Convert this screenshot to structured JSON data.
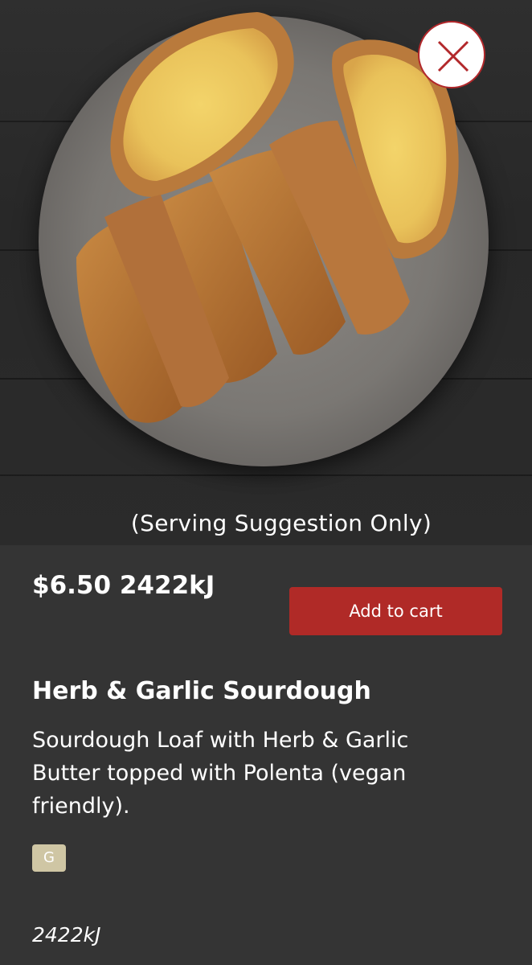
{
  "hero": {
    "caption": "(Serving Suggestion Only)",
    "image_description_icon": "bread-plate-image"
  },
  "close_icon": "close-icon",
  "product": {
    "price": "$6.50",
    "kilojoules": "2422kJ",
    "add_to_cart_label": "Add to cart",
    "name": "Herb & Garlic Sourdough",
    "description": "Sourdough Loaf with Herb & Garlic Butter topped with Polenta (vegan friendly).",
    "dietary_badge": "G",
    "kilojoules_footer": "2422kJ"
  },
  "colors": {
    "accent": "#b02a27",
    "background": "#343434",
    "badge": "#cfc6a4"
  }
}
